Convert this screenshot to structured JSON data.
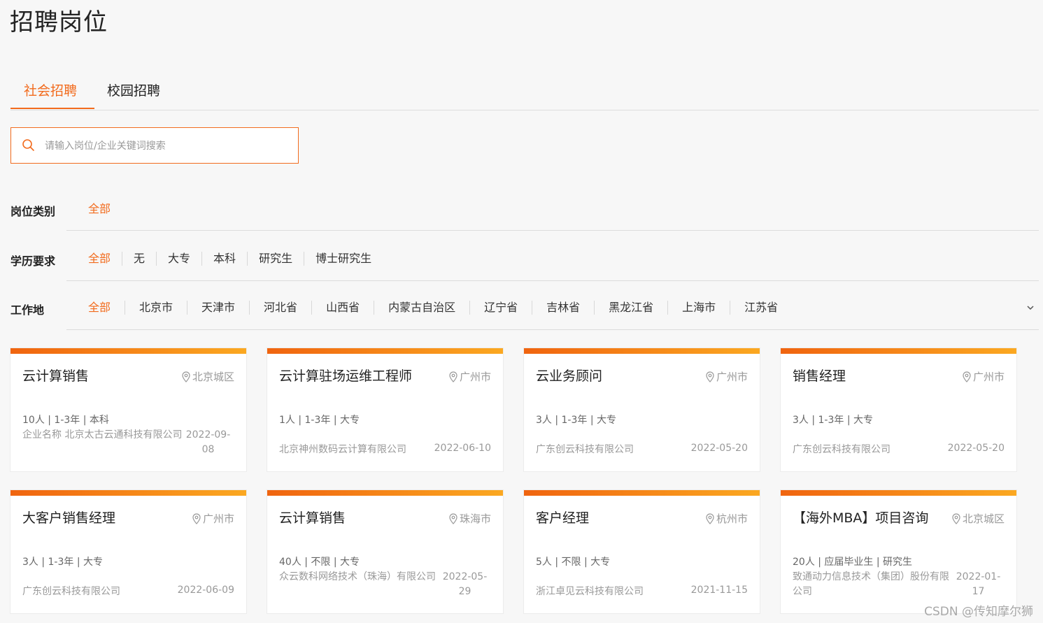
{
  "page": {
    "title": "招聘岗位"
  },
  "tabs": [
    {
      "label": "社会招聘",
      "active": true
    },
    {
      "label": "校园招聘",
      "active": false
    }
  ],
  "search": {
    "placeholder": "请输入岗位/企业关键词搜索",
    "icon": "search-icon"
  },
  "filters": {
    "category": {
      "label": "岗位类别",
      "options": [
        "全部"
      ],
      "selected": "全部"
    },
    "education": {
      "label": "学历要求",
      "options": [
        "全部",
        "无",
        "大专",
        "本科",
        "研究生",
        "博士研究生"
      ],
      "selected": "全部"
    },
    "location": {
      "label": "工作地",
      "options": [
        "全部",
        "北京市",
        "天津市",
        "河北省",
        "山西省",
        "内蒙古自治区",
        "辽宁省",
        "吉林省",
        "黑龙江省",
        "上海市",
        "江苏省"
      ],
      "selected": "全部",
      "expand_icon": "chevron-down-icon"
    }
  },
  "jobs": [
    {
      "title": "云计算销售",
      "location": "北京城区",
      "requirements": "10人 | 1-3年 | 本科",
      "company": "企业名称 北京太古云通科技有限公司",
      "date": "2022-09-08"
    },
    {
      "title": "云计算驻场运维工程师",
      "location": "广州市",
      "requirements": "1人 | 1-3年 | 大专",
      "company": "北京神州数码云计算有限公司",
      "date": "2022-06-10"
    },
    {
      "title": "云业务顾问",
      "location": "广州市",
      "requirements": "3人 | 1-3年 | 大专",
      "company": "广东创云科技有限公司",
      "date": "2022-05-20"
    },
    {
      "title": "销售经理",
      "location": "广州市",
      "requirements": "3人 | 1-3年 | 大专",
      "company": "广东创云科技有限公司",
      "date": "2022-05-20"
    },
    {
      "title": "大客户销售经理",
      "location": "广州市",
      "requirements": "3人 | 1-3年 | 大专",
      "company": "广东创云科技有限公司",
      "date": "2022-06-09"
    },
    {
      "title": "云计算销售",
      "location": "珠海市",
      "requirements": "40人 | 不限 | 大专",
      "company": "众云数科网络技术（珠海）有限公司",
      "date": "2022-05-29"
    },
    {
      "title": "客户经理",
      "location": "杭州市",
      "requirements": "5人 | 不限 | 大专",
      "company": "浙江卓见云科技有限公司",
      "date": "2021-11-15"
    },
    {
      "title": "【海外MBA】项目咨询",
      "location": "北京城区",
      "requirements": "20人 | 应届毕业生 | 研究生",
      "company": "致通动力信息技术（集团）股份有限公司",
      "date": "2022-01-17"
    }
  ],
  "watermark": "CSDN @传知摩尔狮",
  "colors": {
    "accent": "#f26b1d",
    "bar_start": "#f0640f",
    "bar_end": "#fba821"
  }
}
